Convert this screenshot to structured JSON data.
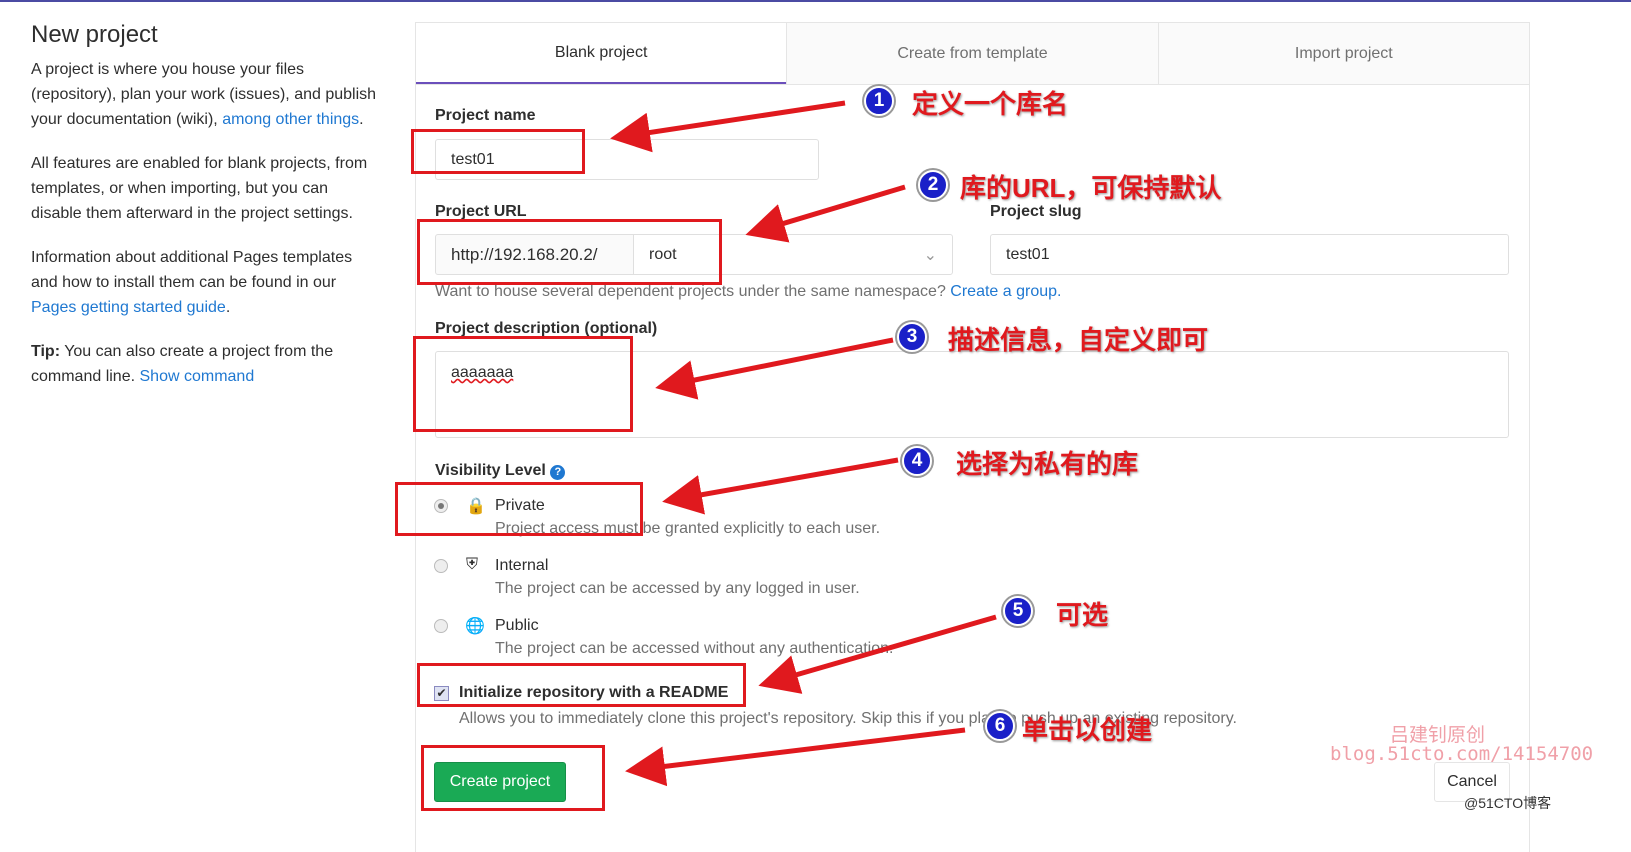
{
  "sidebar": {
    "title": "New project",
    "p1": "A project is where you house your files (repository), plan your work (issues), and publish your documentation (wiki), ",
    "p1_link": "among other things",
    "p2": "All features are enabled for blank projects, from templates, or when importing, but you can disable them afterward in the project settings.",
    "p3": "Information about additional Pages templates and how to install them can be found in our ",
    "p3_link": "Pages getting started guide",
    "tip_label": "Tip:",
    "tip": " You can also create a project from the command line. ",
    "tip_link": "Show command"
  },
  "tabs": [
    "Blank project",
    "Create from template",
    "Import project"
  ],
  "form": {
    "project_name_label": "Project name",
    "project_name": "test01",
    "project_url_label": "Project URL",
    "url_prefix": "http://192.168.20.2/",
    "namespace": "root",
    "slug_label": "Project slug",
    "slug": "test01",
    "group_help": "Want to house several dependent projects under the same namespace? ",
    "group_link": "Create a group.",
    "desc_label": "Project description (optional)",
    "desc": "aaaaaaa",
    "visibility_label": "Visibility Level",
    "visibility": [
      {
        "name": "Private",
        "desc": "Project access must be granted explicitly to each user.",
        "selected": true,
        "icon": "lock-icon"
      },
      {
        "name": "Internal",
        "desc": "The project can be accessed by any logged in user.",
        "selected": false,
        "icon": "shield-icon"
      },
      {
        "name": "Public",
        "desc": "The project can be accessed without any authentication.",
        "selected": false,
        "icon": "globe-icon"
      }
    ],
    "readme_label": "Initialize repository with a README",
    "readme_checked": true,
    "readme_help": "Allows you to immediately clone this project's repository. Skip this if you plan to push up an existing repository.",
    "create": "Create project",
    "cancel": "Cancel"
  },
  "annotations": [
    "定义一个库名",
    "库的URL，可保持默认",
    "描述信息，自定义即可",
    "选择为私有的库",
    "可选",
    "单击以创建"
  ],
  "watermark": {
    "author": "吕建钊原创",
    "blog": "blog.51cto.com/14154700",
    "site": "@51CTO博客"
  },
  "colors": {
    "accent": "#6b4fbb",
    "create": "#1aaa55",
    "annotation": "#e0191e"
  }
}
